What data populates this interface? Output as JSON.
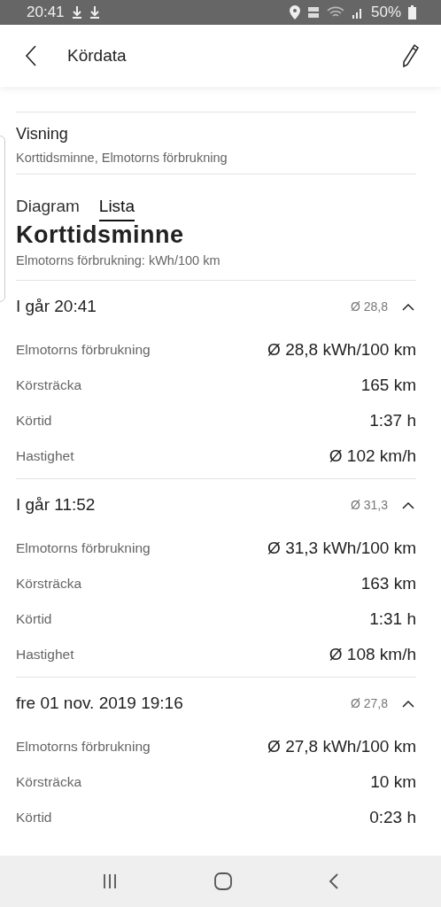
{
  "status_bar": {
    "time": "20:41",
    "battery": "50%"
  },
  "header": {
    "title": "Kördata"
  },
  "view": {
    "label": "Visning",
    "value": "Korttidsminne, Elmotorns förbrukning"
  },
  "tabs": [
    {
      "label": "Diagram",
      "selected": false
    },
    {
      "label": "Lista",
      "selected": true
    }
  ],
  "section": {
    "title": "Korttidsminne",
    "subtitle": "Elmotorns förbrukning: kWh/100 km"
  },
  "trips": [
    {
      "date": "I går 20:41",
      "average": "Ø 28,8",
      "expanded": true,
      "rows": [
        {
          "label": "Elmotorns förbrukning",
          "value": "Ø 28,8 kWh/100 km"
        },
        {
          "label": "Körsträcka",
          "value": "165 km"
        },
        {
          "label": "Körtid",
          "value": "1:37 h"
        },
        {
          "label": "Hastighet",
          "value": "Ø 102 km/h"
        }
      ]
    },
    {
      "date": "I går 11:52",
      "average": "Ø 31,3",
      "expanded": true,
      "rows": [
        {
          "label": "Elmotorns förbrukning",
          "value": "Ø 31,3 kWh/100 km"
        },
        {
          "label": "Körsträcka",
          "value": "163 km"
        },
        {
          "label": "Körtid",
          "value": "1:31 h"
        },
        {
          "label": "Hastighet",
          "value": "Ø 108 km/h"
        }
      ]
    },
    {
      "date": "fre 01 nov. 2019 19:16",
      "average": "Ø 27,8",
      "expanded": true,
      "rows": [
        {
          "label": "Elmotorns förbrukning",
          "value": "Ø 27,8 kWh/100 km"
        },
        {
          "label": "Körsträcka",
          "value": "10 km"
        },
        {
          "label": "Körtid",
          "value": "0:23 h"
        }
      ]
    }
  ]
}
